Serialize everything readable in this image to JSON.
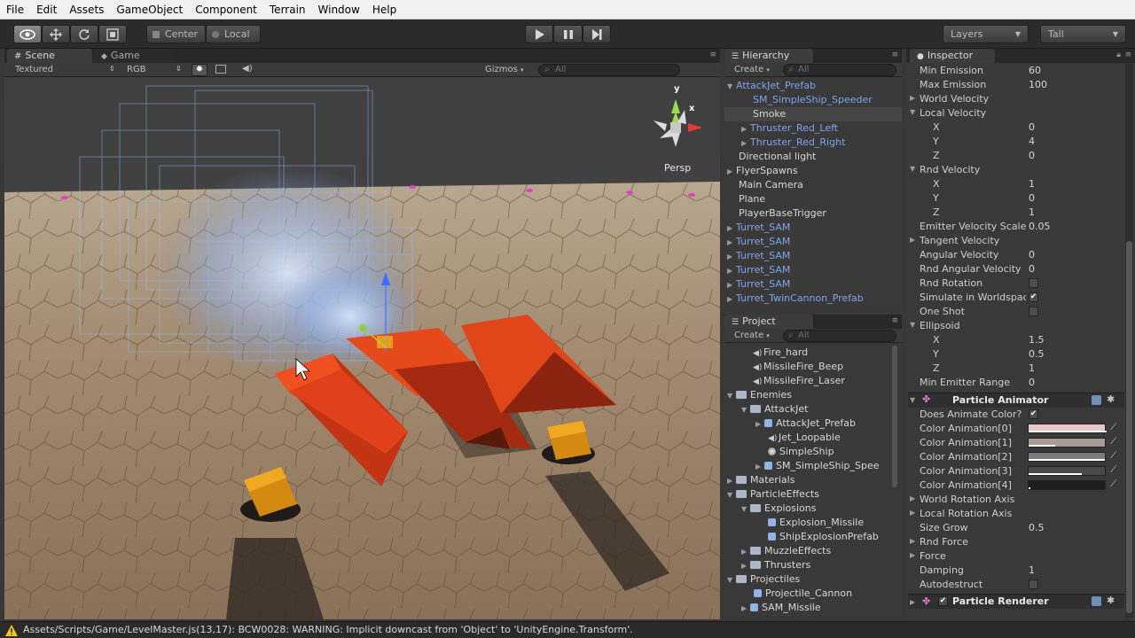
{
  "menu": [
    "File",
    "Edit",
    "Assets",
    "GameObject",
    "Component",
    "Terrain",
    "Window",
    "Help"
  ],
  "toolbar": {
    "pivot": "Center",
    "space": "Local",
    "layers": "Layers",
    "layout": "Tall"
  },
  "scene_panel": {
    "tab_scene": "Scene",
    "tab_game": "Game",
    "render_mode": "Textured",
    "color_mode": "RGB",
    "gizmos": "Gizmos",
    "search_placeholder": "All",
    "persp": "Persp",
    "axis_y": "y",
    "axis_x": "x"
  },
  "hierarchy": {
    "title": "Hierarchy",
    "create": "Create",
    "search_placeholder": "All",
    "items": [
      "AttackJet_Prefab",
      "SM_SimpleShip_Speeder",
      "Smoke",
      "Thruster_Red_Left",
      "Thruster_Red_Right",
      "Directional light",
      "FlyerSpawns",
      "Main Camera",
      "Plane",
      "PlayerBaseTrigger",
      "Turret_SAM",
      "Turret_SAM",
      "Turret_SAM",
      "Turret_SAM",
      "Turret_SAM",
      "Turret_TwinCannon_Prefab"
    ]
  },
  "project": {
    "title": "Project",
    "create": "Create",
    "search_placeholder": "All",
    "items": [
      "Fire_hard",
      "MissileFire_Beep",
      "MissileFire_Laser",
      "Enemies",
      "AttackJet",
      "AttackJet_Prefab",
      "Jet_Loopable",
      "SimpleShip",
      "SM_SimpleShip_Spee",
      "Materials",
      "ParticleEffects",
      "Explosions",
      "Explosion_Missile",
      "ShipExplosionPrefab",
      "MuzzleEffects",
      "Thrusters",
      "Projectiles",
      "Projectile_Cannon",
      "SAM_Missile"
    ]
  },
  "inspector": {
    "title": "Inspector",
    "min_emission_label": "Min Emission",
    "min_emission": "60",
    "max_emission_label": "Max Emission",
    "max_emission": "100",
    "world_velocity": "World Velocity",
    "local_velocity": "Local Velocity",
    "lv_x_label": "X",
    "lv_x": "0",
    "lv_y_label": "Y",
    "lv_y": "4",
    "lv_z_label": "Z",
    "lv_z": "0",
    "rnd_velocity": "Rnd Velocity",
    "rv_x_label": "X",
    "rv_x": "1",
    "rv_y_label": "Y",
    "rv_y": "0",
    "rv_z_label": "Z",
    "rv_z": "1",
    "emitter_velocity_scale_label": "Emitter Velocity Scale",
    "emitter_velocity_scale": "0.05",
    "tangent_velocity": "Tangent Velocity",
    "angular_velocity_label": "Angular Velocity",
    "angular_velocity": "0",
    "rnd_angular_velocity_label": "Rnd Angular Velocity",
    "rnd_angular_velocity": "0",
    "rnd_rotation": "Rnd Rotation",
    "simulate_worldspace": "Simulate in Worldspace",
    "one_shot": "One Shot",
    "ellipsoid": "Ellipsoid",
    "el_x_label": "X",
    "el_x": "1.5",
    "el_y_label": "Y",
    "el_y": "0.5",
    "el_z_label": "Z",
    "el_z": "1",
    "min_emitter_range_label": "Min Emitter Range",
    "min_emitter_range": "0",
    "particle_animator": "Particle Animator",
    "does_animate_color": "Does Animate Color?",
    "color_anims": [
      "Color Animation[0]",
      "Color Animation[1]",
      "Color Animation[2]",
      "Color Animation[3]",
      "Color Animation[4]"
    ],
    "world_rotation_axis": "World Rotation Axis",
    "local_rotation_axis": "Local Rotation Axis",
    "size_grow_label": "Size Grow",
    "size_grow": "0.5",
    "rnd_force": "Rnd Force",
    "force": "Force",
    "damping_label": "Damping",
    "damping": "1",
    "autodestruct": "Autodestruct",
    "particle_renderer": "Particle Renderer"
  },
  "status": {
    "message": "Assets/Scripts/Game/LevelMaster.js(13,17): BCW0028: WARNING: Implicit downcast from 'Object' to 'UnityEngine.Transform'."
  },
  "colors": {
    "accent_blue": "#7ea6e8",
    "ship_red": "#e0401a",
    "turret_orange": "#e69a10",
    "warning_yellow": "#f5c518"
  }
}
